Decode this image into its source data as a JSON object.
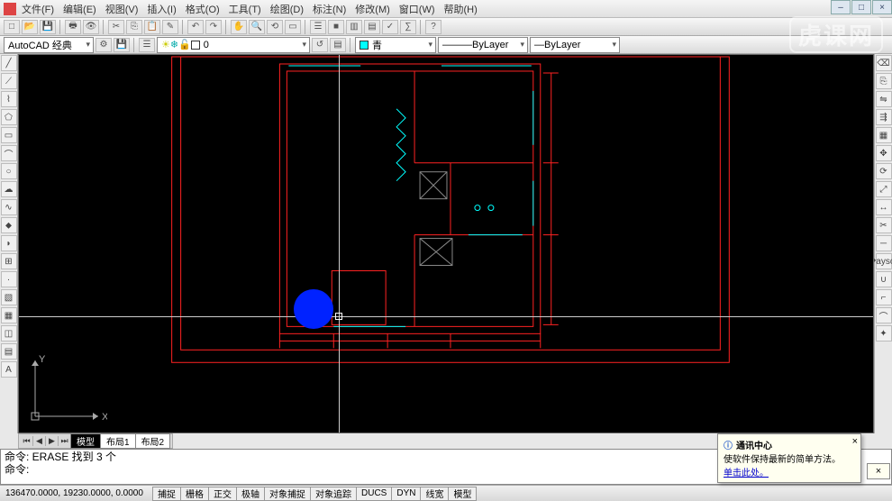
{
  "menu": {
    "items": [
      "文件(F)",
      "编辑(E)",
      "视图(V)",
      "插入(I)",
      "格式(O)",
      "工具(T)",
      "绘图(D)",
      "标注(N)",
      "修改(M)",
      "窗口(W)",
      "帮助(H)"
    ]
  },
  "workspace": {
    "name": "AutoCAD 经典"
  },
  "layer": {
    "current": "0",
    "swatch": "#ffffff"
  },
  "props": {
    "color": "青",
    "color_swatch": "#00ffff",
    "linetype": "ByLayer",
    "lineweight": "ByLayer"
  },
  "tabs": {
    "items": [
      "模型",
      "布局1",
      "布局2"
    ],
    "active": 0
  },
  "command": {
    "history_line": "命令:  ERASE 找到 3 个",
    "prompt": "命令:"
  },
  "status": {
    "coords": "136470.0000, 19230.0000, 0.0000",
    "toggles": [
      "捕捉",
      "栅格",
      "正交",
      "极轴",
      "对象捕捉",
      "对象追踪",
      "DUCS",
      "DYN",
      "线宽",
      "模型"
    ]
  },
  "ucs": {
    "x": "X",
    "y": "Y"
  },
  "notification": {
    "title": "通讯中心",
    "body": "使软件保持最新的简单方法。",
    "link": "单击此处。"
  },
  "watermark": "虎课网",
  "left_tool_names": [
    "line-icon",
    "xline-icon",
    "pline-icon",
    "polygon-icon",
    "rectangle-icon",
    "arc-icon",
    "circle-icon",
    "revcloud-icon",
    "spline-icon",
    "ellipse-icon",
    "ellipsearc-icon",
    "block-icon",
    "point-icon",
    "hatch-icon",
    "gradient-icon",
    "region-icon",
    "table-icon",
    "mtext-icon"
  ],
  "left_tool_glyphs": [
    "╱",
    "⟋",
    "⌇",
    "⬠",
    "▭",
    "⌒",
    "○",
    "☁",
    "∿",
    "⬥",
    "◗",
    "⊞",
    "·",
    "▧",
    "▦",
    "◫",
    "▤",
    "A"
  ],
  "right_tool_names": [
    "erase-icon",
    "copy-icon",
    "mirror-icon",
    "offset-icon",
    "array-icon",
    "move-icon",
    "rotate-icon",
    "scale-icon",
    "stretch-icon",
    "trim-icon",
    "extend-icon",
    "break-icon",
    "join-icon",
    "chamfer-icon",
    "fillet-icon",
    "explode-icon"
  ],
  "right_tool_glyphs": [
    "⌫",
    "⎘",
    "⇋",
    "⇶",
    "▦",
    "✥",
    "⟳",
    "⤢",
    "↔",
    "✂",
    "─",
    "�ayson",
    "∪",
    "⌐",
    "⌒",
    "✦"
  ],
  "tb1_names": [
    "new-icon",
    "open-icon",
    "save-icon",
    "print-icon",
    "plot-preview-icon",
    "cut-icon",
    "copy-clip-icon",
    "paste-icon",
    "match-icon",
    "undo-icon",
    "redo-icon",
    "pan-icon",
    "zoom-rt-icon",
    "zoom-prev-icon",
    "zoom-win-icon",
    "props-icon",
    "dcenter-icon",
    "tool-pal-icon",
    "sheet-icon",
    "markup-icon",
    "calc-icon",
    "help-icon"
  ],
  "tb1_glyphs": [
    "□",
    "📂",
    "💾",
    "🖶",
    "👁",
    "✂",
    "⎘",
    "📋",
    "✎",
    "↶",
    "↷",
    "✋",
    "🔍",
    "⟲",
    "▭",
    "☰",
    "■",
    "▥",
    "▤",
    "✓",
    "∑",
    "?"
  ],
  "window_controls": [
    "–",
    "□",
    "×"
  ]
}
